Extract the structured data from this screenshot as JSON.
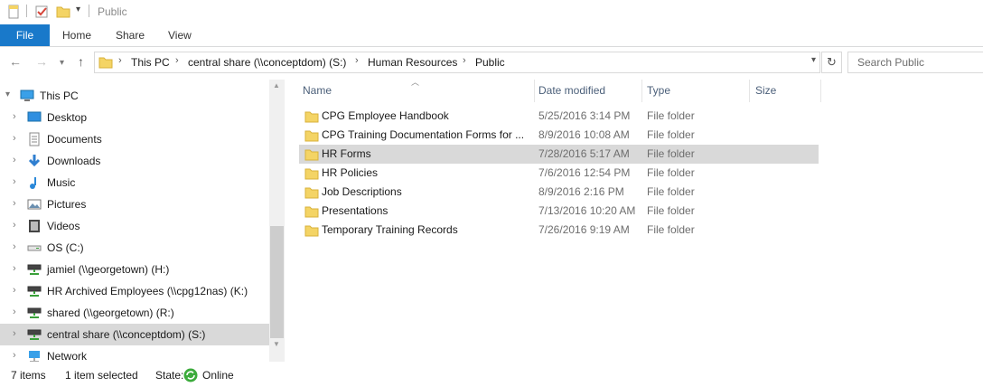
{
  "window": {
    "title": "Public"
  },
  "ribbon": {
    "file": "File",
    "tabs": [
      "Home",
      "Share",
      "View"
    ]
  },
  "address": {
    "crumbs": [
      "This PC",
      "central share (\\\\conceptdom) (S:)",
      "Human Resources",
      "Public"
    ],
    "search_placeholder": "Search Public"
  },
  "nav": {
    "root": "This PC",
    "items": [
      {
        "label": "Desktop",
        "icon": "desktop-icon"
      },
      {
        "label": "Documents",
        "icon": "documents-icon"
      },
      {
        "label": "Downloads",
        "icon": "downloads-icon"
      },
      {
        "label": "Music",
        "icon": "music-icon"
      },
      {
        "label": "Pictures",
        "icon": "pictures-icon"
      },
      {
        "label": "Videos",
        "icon": "videos-icon"
      },
      {
        "label": "OS (C:)",
        "icon": "drive-icon"
      },
      {
        "label": "jamiel (\\\\georgetown) (H:)",
        "icon": "network-drive-icon"
      },
      {
        "label": "HR Archived Employees (\\\\cpg12nas) (K:)",
        "icon": "network-drive-icon"
      },
      {
        "label": "shared (\\\\georgetown) (R:)",
        "icon": "network-drive-icon"
      },
      {
        "label": "central share (\\\\conceptdom) (S:)",
        "icon": "network-drive-icon",
        "selected": true
      },
      {
        "label": "Network",
        "icon": "network-icon"
      }
    ]
  },
  "columns": [
    "Name",
    "Date modified",
    "Type",
    "Size"
  ],
  "files": [
    {
      "name": "CPG Employee Handbook",
      "date": "5/25/2016 3:14 PM",
      "type": "File folder"
    },
    {
      "name": "CPG Training Documentation Forms for ...",
      "date": "8/9/2016 10:08 AM",
      "type": "File folder"
    },
    {
      "name": "HR Forms",
      "date": "7/28/2016 5:17 AM",
      "type": "File folder",
      "selected": true
    },
    {
      "name": "HR Policies",
      "date": "7/6/2016 12:54 PM",
      "type": "File folder"
    },
    {
      "name": "Job Descriptions",
      "date": "8/9/2016 2:16 PM",
      "type": "File folder"
    },
    {
      "name": "Presentations",
      "date": "7/13/2016 10:20 AM",
      "type": "File folder"
    },
    {
      "name": "Temporary Training Records",
      "date": "7/26/2016 9:19 AM",
      "type": "File folder"
    }
  ],
  "status": {
    "count": "7 items",
    "selected": "1 item selected",
    "state_label": "State:",
    "state_value": "Online"
  },
  "colors": {
    "accent": "#1979ca",
    "selection": "#d9d9d9",
    "folder": "#f4d465"
  }
}
